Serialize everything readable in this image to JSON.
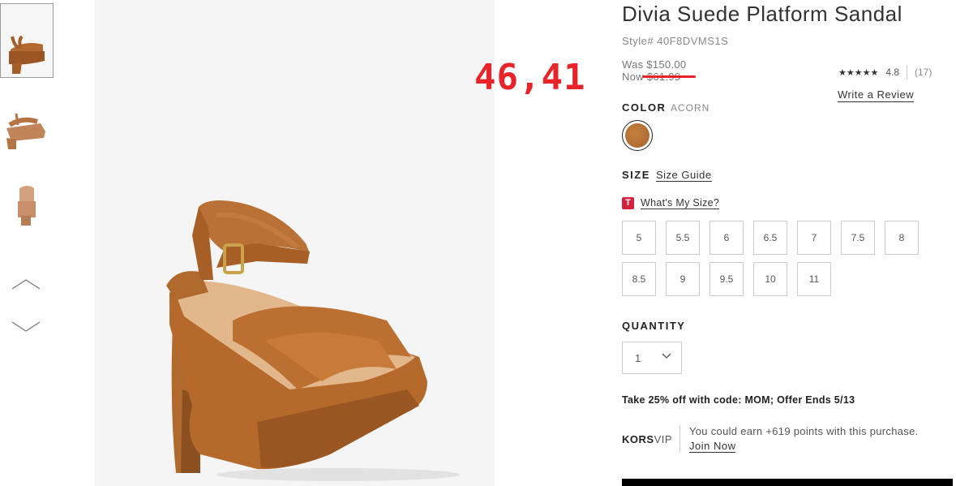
{
  "product": {
    "title": "Divia Suede Platform Sandal",
    "style": "Style# 40F8DVMS1S",
    "was_price": "Was $150.00",
    "now_price_label": "Now",
    "now_price": "$61.99",
    "annotation": "46,41"
  },
  "rating": {
    "stars": "★★★★★",
    "score": "4.8",
    "count": "(17)",
    "write_review": "Write a Review"
  },
  "color": {
    "label": "COLOR",
    "value": "ACORN",
    "swatch_color": "#b36a30"
  },
  "size": {
    "label": "SIZE",
    "guide": "Size Guide",
    "whats_my_size": "What's My Size?",
    "t_icon": "T",
    "options": [
      "5",
      "5.5",
      "6",
      "6.5",
      "7",
      "7.5",
      "8",
      "8.5",
      "9",
      "9.5",
      "10",
      "11"
    ]
  },
  "quantity": {
    "label": "QUANTITY",
    "value": "1"
  },
  "promo": "Take 25% off with code: MOM; Offer Ends 5/13",
  "korsvip": {
    "brand_bold": "KORS",
    "brand_light": "VIP",
    "earn_text": "You could earn +619 points with this purchase.",
    "join": "Join Now"
  },
  "icons": {
    "up": "chevron-up-icon",
    "down": "chevron-down-icon"
  },
  "colors": {
    "accent_red": "#e8232a",
    "t_icon_bg": "#d6213c"
  }
}
